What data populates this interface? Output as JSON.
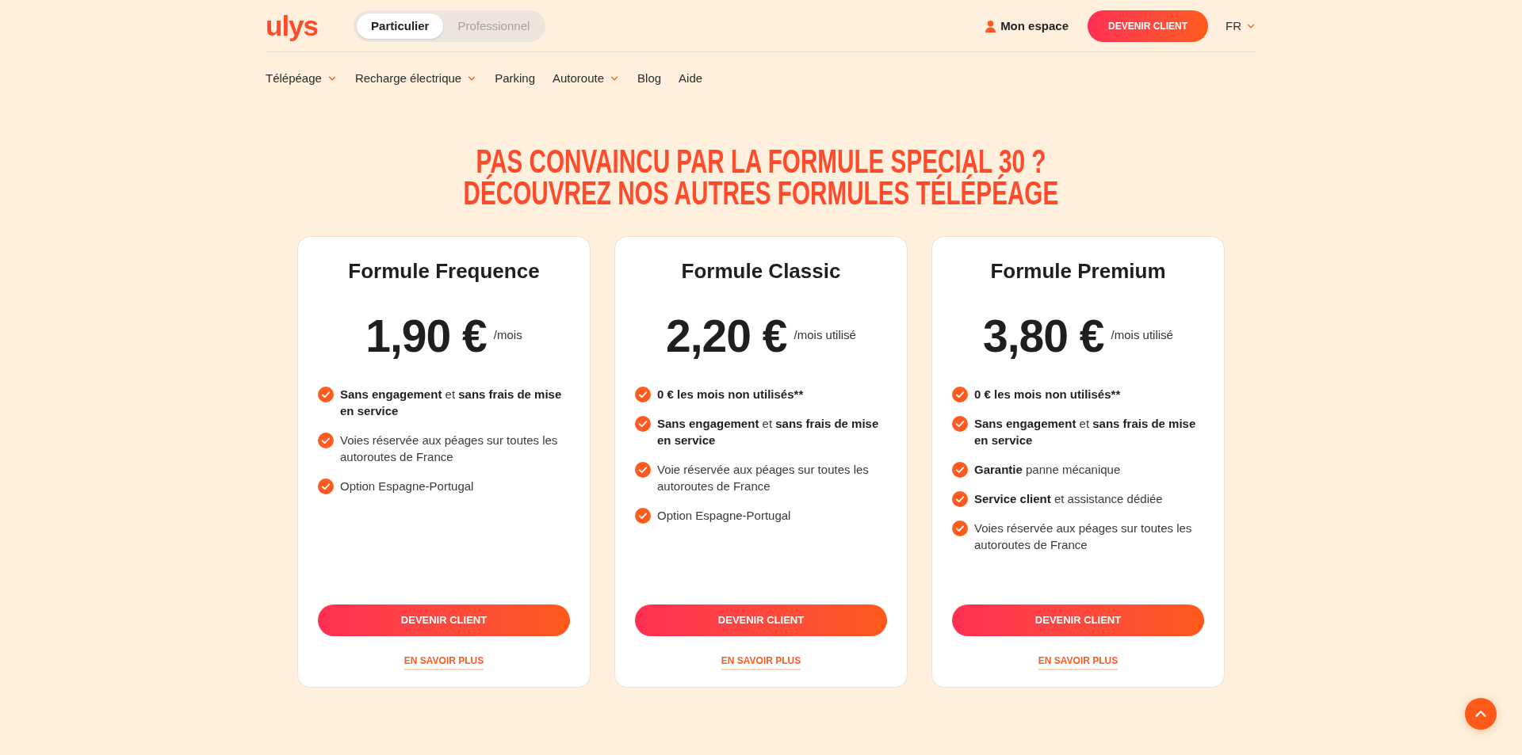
{
  "header": {
    "logo": "ulys",
    "segments": [
      {
        "label": "Particulier",
        "selected": true
      },
      {
        "label": "Professionnel",
        "selected": false
      }
    ],
    "account_link": "Mon espace",
    "cta_button": "DEVENIR CLIENT",
    "language": "FR"
  },
  "nav": [
    {
      "label": "Télépéage",
      "has_dropdown": true
    },
    {
      "label": "Recharge électrique",
      "has_dropdown": true
    },
    {
      "label": "Parking",
      "has_dropdown": false
    },
    {
      "label": "Autoroute",
      "has_dropdown": true
    },
    {
      "label": "Blog",
      "has_dropdown": false
    },
    {
      "label": "Aide",
      "has_dropdown": false
    }
  ],
  "heading_lines": [
    "PAS CONVAINCU PAR LA FORMULE SPECIAL 30 ?",
    "DÉCOUVREZ NOS AUTRES FORMULES TÉLÉPÉAGE"
  ],
  "plans": [
    {
      "title": "Formule Frequence",
      "price": "1,90 €",
      "period": "/mois",
      "features": [
        {
          "text": "**Sans engagement** et **sans frais de mise en service**",
          "bold": false
        },
        {
          "text": "Voies réservée aux péages sur toutes les autoroutes de France",
          "bold": false
        },
        {
          "text": "Option Espagne-Portugal",
          "bold": false
        }
      ],
      "button": "DEVENIR CLIENT",
      "link": "EN SAVOIR PLUS"
    },
    {
      "title": "Formule Classic",
      "price": "2,20 €",
      "period": "/mois utilisé",
      "features": [
        {
          "text": "0 € les mois non utilisés**",
          "bold": true
        },
        {
          "text": "**Sans engagement** et **sans frais de mise en service**",
          "bold": false
        },
        {
          "text": "Voie réservée aux péages sur toutes les autoroutes de France",
          "bold": false
        },
        {
          "text": "Option Espagne-Portugal",
          "bold": false
        }
      ],
      "button": "DEVENIR CLIENT",
      "link": "EN SAVOIR PLUS"
    },
    {
      "title": "Formule Premium",
      "price": "3,80 €",
      "period": "/mois utilisé",
      "features": [
        {
          "text": "0 € les mois non utilisés**",
          "bold": true
        },
        {
          "text": "**Sans engagement** et **sans frais de mise en service**",
          "bold": false
        },
        {
          "text": "**Garantie** panne mécanique",
          "bold": false
        },
        {
          "text": "**Service client** et assistance dédiée",
          "bold": false
        },
        {
          "text": "Voies réservée aux péages sur toutes les autoroutes de France",
          "bold": false
        }
      ],
      "button": "DEVENIR CLIENT",
      "link": "EN SAVOIR PLUS"
    }
  ]
}
